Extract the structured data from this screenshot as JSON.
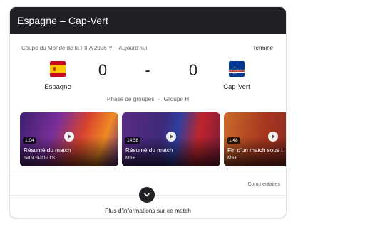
{
  "header": {
    "title": "Espagne – Cap-Vert"
  },
  "match": {
    "competition": "Coupe du Monde de la FIFA 2026™",
    "date": "Aujourd'hui",
    "status": "Terminé",
    "home": {
      "name": "Espagne",
      "score": "0",
      "flag": "spain-flag-icon"
    },
    "separator": "-",
    "away": {
      "name": "Cap-Vert",
      "score": "0",
      "flag": "cape-verde-flag-icon"
    },
    "stage": "Phase de groupes",
    "group": "Groupe H"
  },
  "videos": [
    {
      "duration": "1:04",
      "title": "Résumé du match",
      "source": "beIN SPORTS"
    },
    {
      "duration": "14:58",
      "title": "Résumé du match",
      "source": "M6+"
    },
    {
      "duration": "1:48",
      "title": "Fin d'un match sous t",
      "source": "M6+"
    }
  ],
  "comments_label": "Commentaires",
  "more_info_label": "Plus d'informations sur ce match",
  "colors": {
    "header_bg": "#202124",
    "spain_red": "#c60b1e",
    "spain_yellow": "#ffc400",
    "cape_verde_blue": "#003893",
    "cape_verde_red": "#cf2027"
  }
}
